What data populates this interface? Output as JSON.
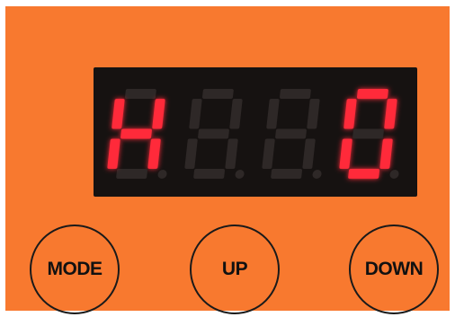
{
  "display": {
    "digits": [
      {
        "segments": [
          "b",
          "c",
          "e",
          "f",
          "g"
        ],
        "lit": true
      },
      {
        "segments": [],
        "lit": false
      },
      {
        "segments": [],
        "lit": false
      },
      {
        "segments": [
          "a",
          "b",
          "c",
          "d",
          "e",
          "f"
        ],
        "lit": true
      }
    ],
    "readout": "H  0",
    "colors": {
      "lit": "#ff2a3a",
      "unlit": "#2e2827",
      "background": "#161211",
      "panel": "#f8792f"
    }
  },
  "buttons": {
    "mode": "MODE",
    "up": "UP",
    "down": "DOWN"
  }
}
